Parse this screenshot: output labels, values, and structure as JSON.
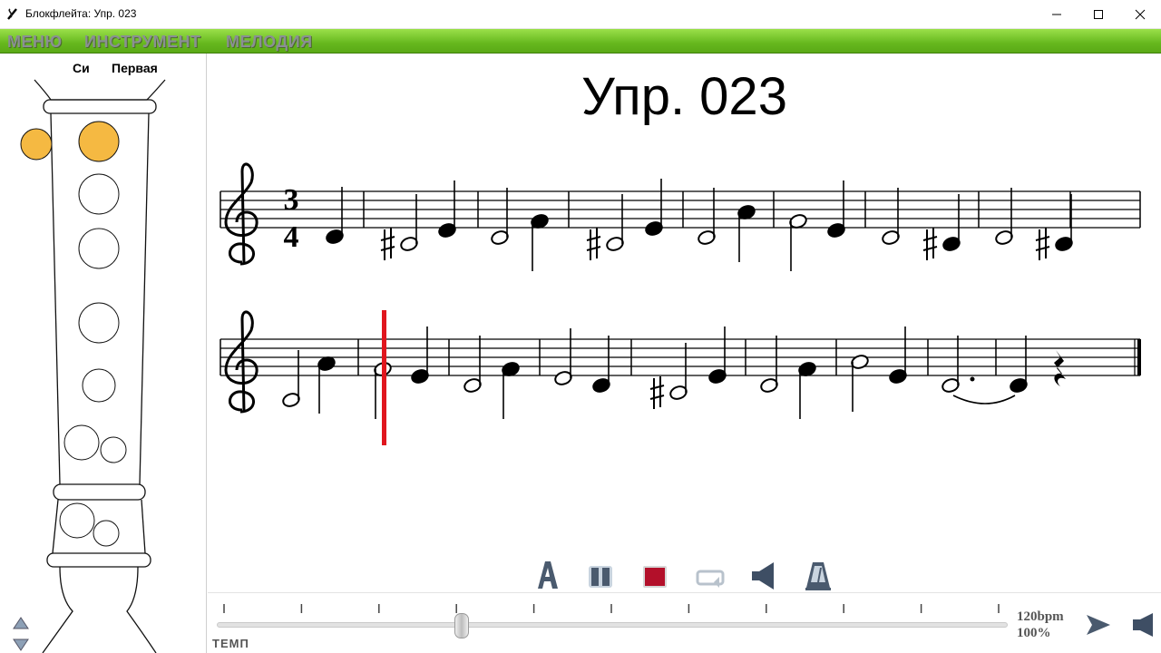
{
  "window": {
    "title": "Блокфлейта: Упр. 023"
  },
  "menu": [
    "МЕНЮ",
    "ИНСТРУМЕНТ",
    "МЕЛОДИЯ"
  ],
  "instrument": {
    "note": "Си",
    "octave": "Первая",
    "hole_fill_color": "#f5b942"
  },
  "score": {
    "title": "Упр. 023",
    "time_signature": {
      "beats": "3",
      "unit": "4"
    },
    "cursor_color": "#e0161e"
  },
  "toolbar": {
    "icons": [
      "letter-a-icon",
      "pause-icon",
      "stop-icon",
      "repeat-icon",
      "speaker-icon",
      "metronome-icon"
    ]
  },
  "tempo": {
    "label": "ТЕМП",
    "bpm": "120bpm",
    "percent": "100%",
    "slider_fraction": 0.31
  },
  "colors": {
    "menubar": "#6cbf22",
    "stop": "#b3102a",
    "toolbar_icon": "#3b4a5e"
  }
}
